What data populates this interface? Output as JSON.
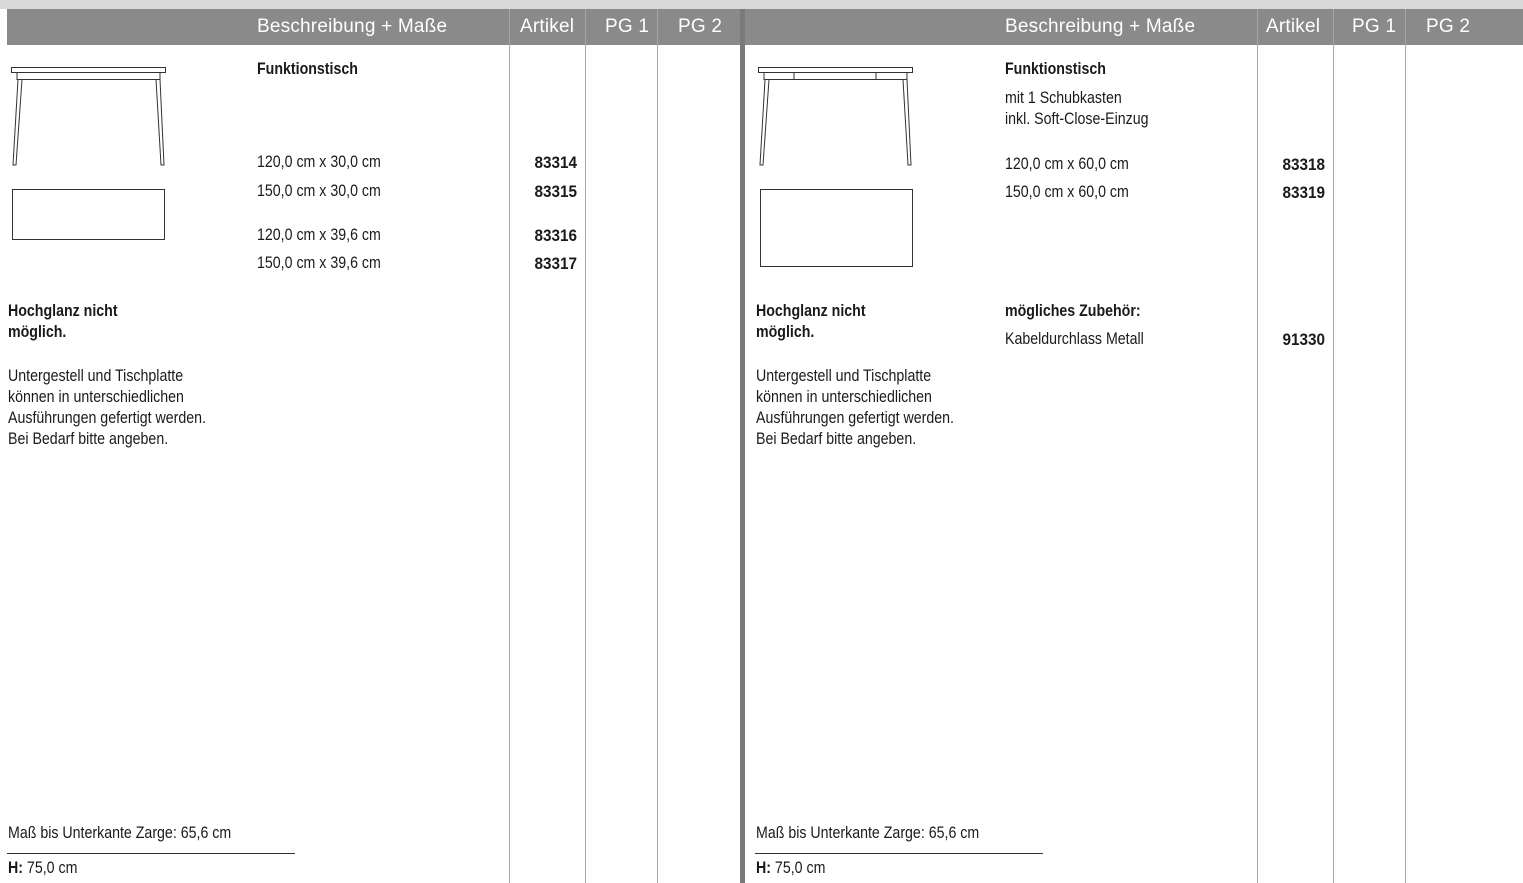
{
  "header": {
    "beschreibung": "Beschreibung + Maße",
    "artikel": "Artikel",
    "pg1": "PG 1",
    "pg2": "PG 2"
  },
  "left": {
    "title": "Funktionstisch",
    "rows": [
      {
        "size": "120,0 cm x 30,0 cm",
        "article": "83314"
      },
      {
        "size": "150,0 cm x 30,0 cm",
        "article": "83315"
      },
      {
        "size": "120,0 cm x 39,6 cm",
        "article": "83316"
      },
      {
        "size": "150,0 cm x 39,6 cm",
        "article": "83317"
      }
    ],
    "warning": "Hochglanz nicht\nmöglich.",
    "note": "Untergestell und Tischplatte\nkönnen in unterschiedlichen\nAusführungen gefertigt werden.\nBei Bedarf bitte angeben.",
    "zarge": "Maß bis Unterkante Zarge: 65,6 cm",
    "height_label": "H:",
    "height_value": " 75,0 cm"
  },
  "right": {
    "title": "Funktionstisch",
    "subtitle": "mit 1 Schubkasten\ninkl. Soft-Close-Einzug",
    "rows": [
      {
        "size": "120,0 cm x 60,0 cm",
        "article": "83318"
      },
      {
        "size": "150,0 cm x 60,0 cm",
        "article": "83319"
      }
    ],
    "warning": "Hochglanz nicht\nmöglich.",
    "accessory_title": "mögliches Zubehör:",
    "accessory": {
      "name": "Kabeldurchlass Metall",
      "article": "91330"
    },
    "note": "Untergestell und Tischplatte\nkönnen in unterschiedlichen\nAusführungen gefertigt werden.\nBei Bedarf bitte angeben.",
    "zarge": "Maß bis Unterkante Zarge: 65,6 cm",
    "height_label": "H:",
    "height_value": " 75,0 cm"
  },
  "colors": {
    "header_bg": "#8a8a8a",
    "separator": "#7a7a7a",
    "text": "#1a1a1a"
  }
}
